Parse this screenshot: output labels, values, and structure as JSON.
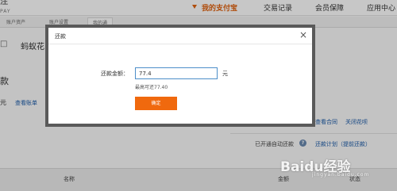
{
  "nav": {
    "logo_top": "注",
    "logo_bottom": "PAY",
    "items": [
      {
        "label": "我的支付宝"
      },
      {
        "label": "交易记录"
      },
      {
        "label": "会员保障"
      },
      {
        "label": "应用中心"
      }
    ]
  },
  "subtabs": [
    "账户资产",
    "账户设置",
    "我的通"
  ],
  "page": {
    "arrow": "□",
    "title": "蚂蚁花",
    "section": "款",
    "unit": "元",
    "view_bill": "查看账单",
    "view_contract": "查看合同",
    "close_huabei": "关闭花呗",
    "auto_repay_text": "已开通自动还款",
    "repay_plan_link": "还款计划（提前还款）",
    "col_name": "名称",
    "col_amount": "金额",
    "col_status": "状态"
  },
  "modal": {
    "title": "还款",
    "amount_label": "还款金额：",
    "amount_value": "77.4",
    "amount_unit": "元",
    "max_hint": "最高可还77.40",
    "confirm_label": "确定"
  },
  "watermark": {
    "text": "Baidu经验",
    "sub": "jingyan.baidu.com"
  },
  "colors": {
    "accent": "#e1620f",
    "button": "#f0690e",
    "link": "#1a5aa8",
    "input_border": "#4d8ec9"
  }
}
